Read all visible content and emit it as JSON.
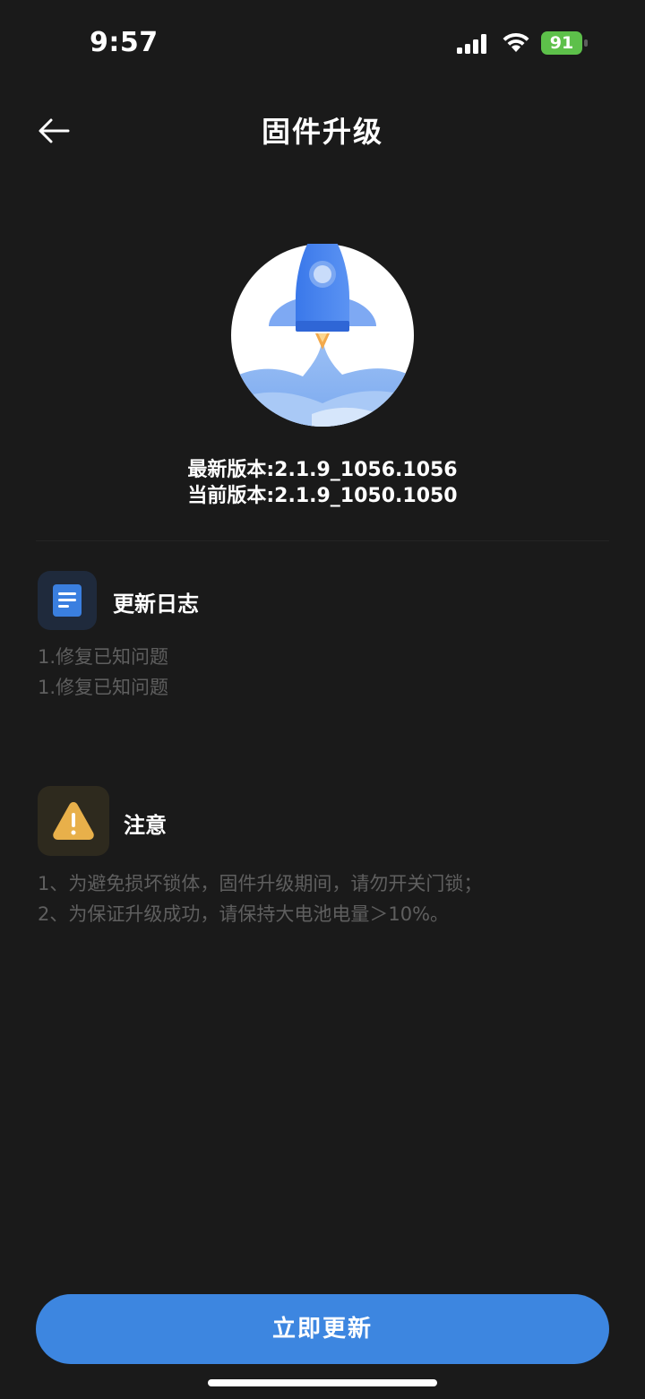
{
  "status_bar": {
    "time": "9:57",
    "battery": "91"
  },
  "nav": {
    "title": "固件升级"
  },
  "versions": {
    "latest": "最新版本:2.1.9_1056.1056",
    "current": "当前版本:2.1.9_1050.1050"
  },
  "changelog": {
    "title": "更新日志",
    "icon": "document-icon",
    "lines": [
      "1.修复已知问题",
      "1.修复已知问题"
    ]
  },
  "notice": {
    "title": "注意",
    "icon": "warning-icon",
    "lines": [
      "1、为避免损坏锁体，固件升级期间，请勿开关门锁；",
      "2、为保证升级成功，请保持大电池电量＞10%。"
    ]
  },
  "actions": {
    "update_label": "立即更新"
  },
  "colors": {
    "background": "#1a1a1a",
    "accent": "#3d86e0",
    "warning": "#e8b04a",
    "battery": "#5dc04a"
  }
}
